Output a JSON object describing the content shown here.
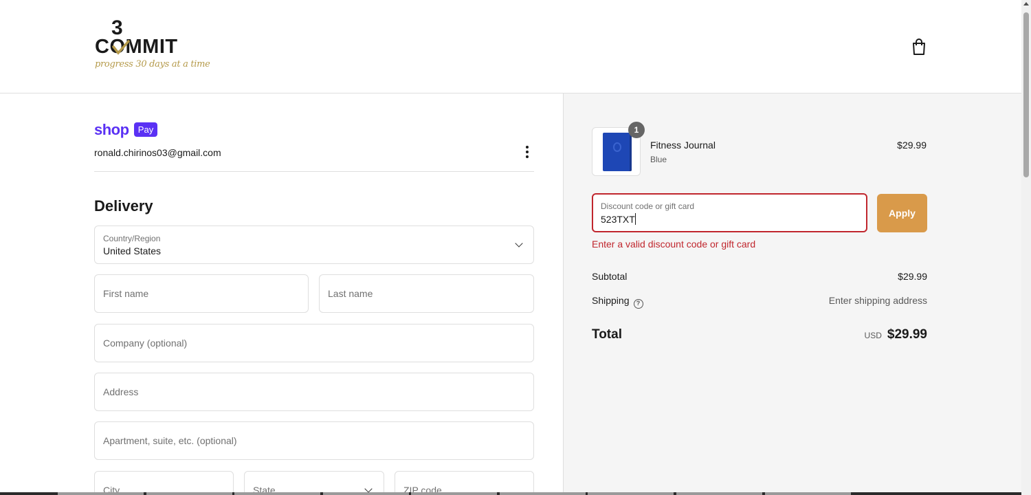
{
  "header": {
    "logo": {
      "number": "3",
      "word": "COMMIT",
      "tagline": "progress 30 days at a time"
    },
    "cart_icon": "shopping-bag-icon"
  },
  "account": {
    "shop_label": "shop",
    "pay_label": "Pay",
    "email": "ronald.chirinos03@gmail.com",
    "menu_icon": "more-vertical-icon"
  },
  "delivery": {
    "title": "Delivery",
    "country": {
      "label": "Country/Region",
      "value": "United States"
    },
    "first_name": {
      "placeholder": "First name"
    },
    "last_name": {
      "placeholder": "Last name"
    },
    "company": {
      "placeholder": "Company (optional)"
    },
    "address": {
      "placeholder": "Address"
    },
    "apartment": {
      "placeholder": "Apartment, suite, etc. (optional)"
    },
    "city": {
      "placeholder": "City"
    },
    "state": {
      "placeholder": "State"
    },
    "zip": {
      "placeholder": "ZIP code"
    }
  },
  "summary": {
    "item": {
      "name": "Fitness Journal",
      "variant": "Blue",
      "price": "$29.99",
      "quantity": "1"
    },
    "discount": {
      "label": "Discount code or gift card",
      "value": "523TXT",
      "apply_label": "Apply",
      "error": "Enter a valid discount code or gift card"
    },
    "subtotal": {
      "label": "Subtotal",
      "value": "$29.99"
    },
    "shipping": {
      "label": "Shipping",
      "value": "Enter shipping address",
      "help_icon": "question-circle-icon"
    },
    "total": {
      "label": "Total",
      "currency": "USD",
      "value": "$29.99"
    }
  },
  "colors": {
    "shop_pay": "#5a31f4",
    "apply_button": "#d99a4a",
    "error": "#c0262d",
    "summary_bg": "#f5f5f5",
    "logo_gold": "#b59a4a"
  }
}
